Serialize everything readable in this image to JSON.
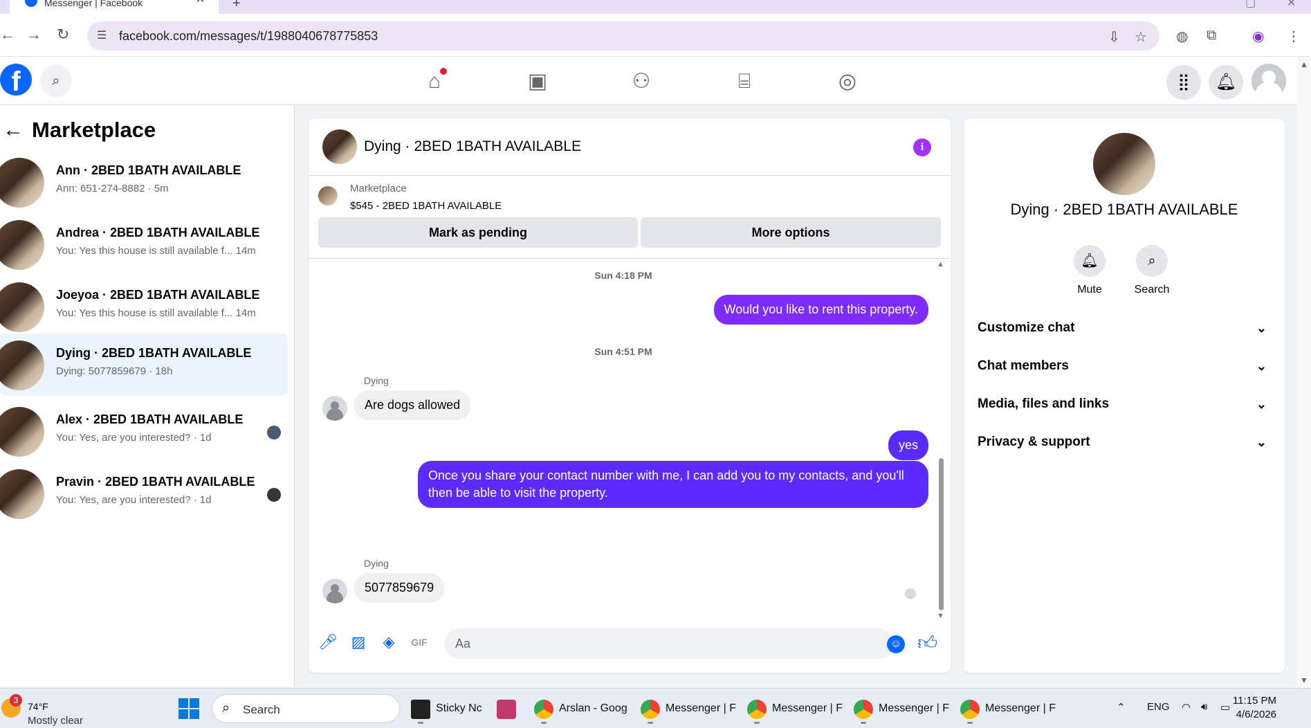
{
  "browser": {
    "tab_title": "Messenger | Facebook",
    "url": "facebook.com/messages/t/1988040678775853"
  },
  "left": {
    "back_icon": "arrow-left-icon",
    "title": "Marketplace",
    "conversations": [
      {
        "name": "Ann · 2BED 1BATH AVAILABLE",
        "preview": "Ann: 651-274-8882 · 5m",
        "active": false
      },
      {
        "name": "Andrea · 2BED 1BATH AVAILABLE",
        "preview": "You: Yes this house is still available f...  14m",
        "active": false
      },
      {
        "name": "Joeyoa · 2BED 1BATH AVAILABLE",
        "preview": "You: Yes this house is still available f...  14m",
        "active": false
      },
      {
        "name": "Dying · 2BED 1BATH AVAILABLE",
        "preview": "Dying: 5077859679 · 18h",
        "active": true
      },
      {
        "name": "Alex · 2BED 1BATH AVAILABLE",
        "preview": "You: Yes, are you interested? · 1d",
        "active": false
      },
      {
        "name": "Pravin · 2BED 1BATH AVAILABLE",
        "preview": "You: Yes, are you interested? · 1d",
        "active": false
      }
    ]
  },
  "chat": {
    "title": "Dying · 2BED 1BATH AVAILABLE",
    "marketplace_label": "Marketplace",
    "listing": "$545 - 2BED 1BATH AVAILABLE",
    "mark_pending": "Mark as pending",
    "more_options": "More options",
    "timestamps": [
      "Sun 4:18 PM",
      "Sun 4:51 PM"
    ],
    "messages": [
      {
        "from": "me",
        "text": "Would you like to rent this property."
      },
      {
        "from": "Dying",
        "text": "Are dogs allowed"
      },
      {
        "from": "me",
        "text": "yes"
      },
      {
        "from": "me",
        "text": "Once you share your contact number with me, I can add you to my contacts, and you'll then be able to visit the property."
      },
      {
        "from": "Dying",
        "text": "5077859679"
      }
    ],
    "sender_name": "Dying",
    "composer_placeholder": "Aa"
  },
  "right": {
    "name": "Dying · 2BED 1BATH AVAILABLE",
    "mute": "Mute",
    "search": "Search",
    "sections": [
      "Customize chat",
      "Chat members",
      "Media, files and links",
      "Privacy & support"
    ]
  },
  "taskbar": {
    "weather_badge": "3",
    "temperature": "74°F",
    "condition": "Mostly clear",
    "search": "Search",
    "apps": [
      "Sticky Nc",
      "Arslan - Goog",
      "Messenger | F",
      "Messenger | F",
      "Messenger | F",
      "Messenger | F"
    ],
    "lang": "ENG",
    "time": "11:15 PM",
    "date": "4/6/2026"
  },
  "colors": {
    "brand": "#0866ff",
    "outgoing_bubble": "#7e2bff",
    "active_row": "#ebf5ff"
  }
}
